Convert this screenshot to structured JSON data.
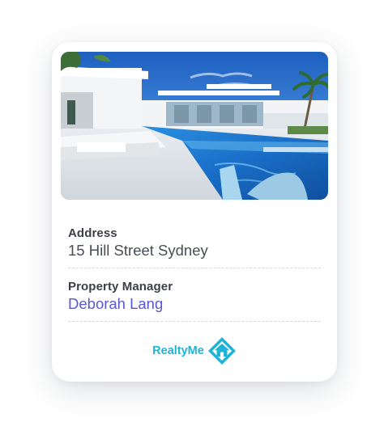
{
  "card": {
    "address_label": "Address",
    "address_value": "15 Hill Street Sydney",
    "manager_label": "Property Manager",
    "manager_value": "Deborah Lang"
  },
  "brand": {
    "name": "RealtyMe",
    "logo_icon": "house-in-diamond-icon",
    "color": "#1fb3d8"
  },
  "colors": {
    "link": "#5a57d3",
    "label": "#3c3f48",
    "pool": "#1a7fd0"
  }
}
